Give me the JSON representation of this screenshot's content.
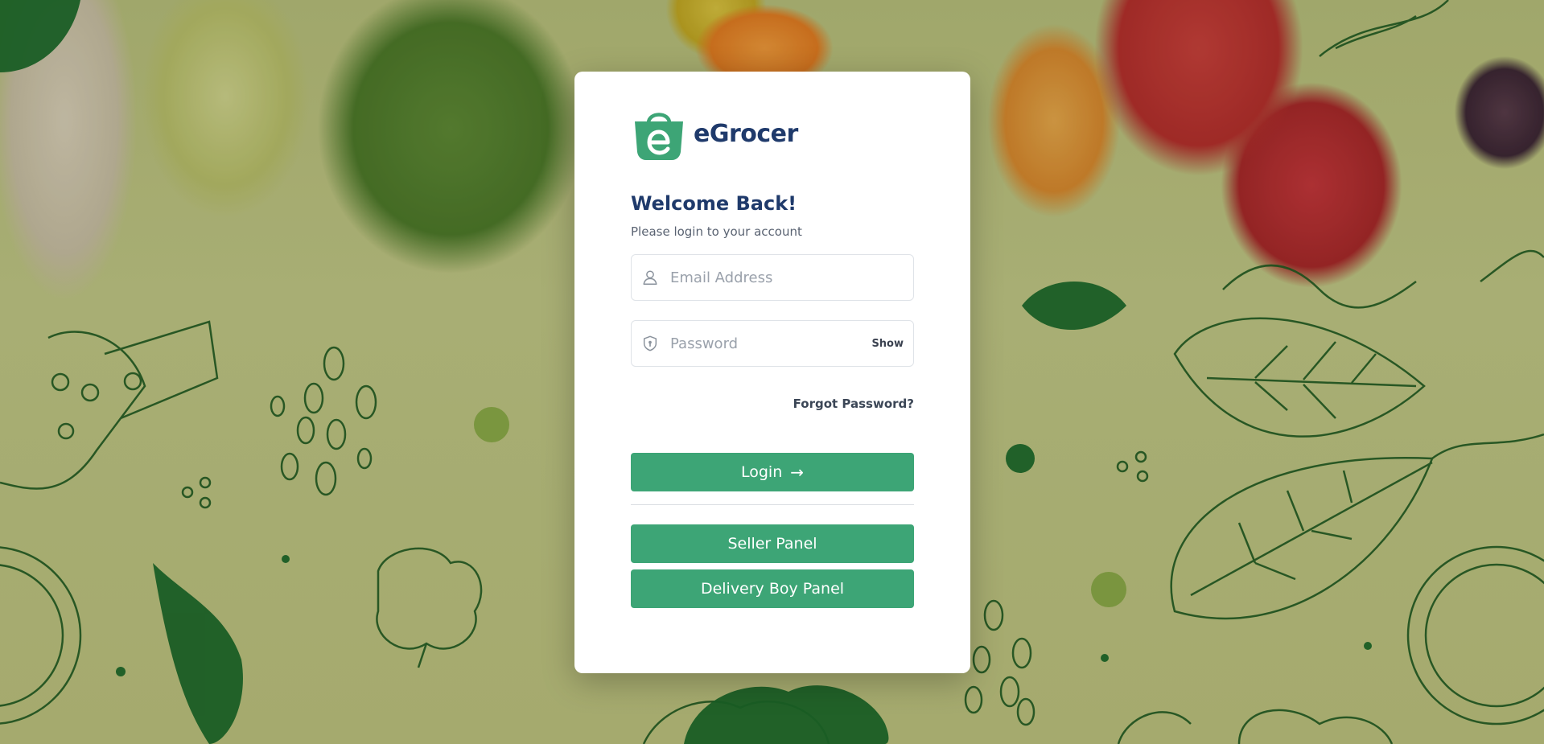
{
  "brand": {
    "name": "eGrocer",
    "logo_icon": "shopping-bag-e-icon",
    "color": "#3da576"
  },
  "login": {
    "heading": "Welcome Back!",
    "subheading": "Please login to your account",
    "email": {
      "placeholder": "Email Address",
      "icon": "user-icon",
      "value": ""
    },
    "password": {
      "placeholder": "Password",
      "icon": "shield-icon",
      "show_label": "Show",
      "value": ""
    },
    "forgot_label": "Forgot Password?",
    "login_label": "Login",
    "login_icon": "arrow-right-icon",
    "seller_label": "Seller Panel",
    "delivery_label": "Delivery Boy Panel"
  },
  "colors": {
    "primary": "#3da576",
    "heading": "#1f3a6b",
    "text": "#5a6372"
  }
}
